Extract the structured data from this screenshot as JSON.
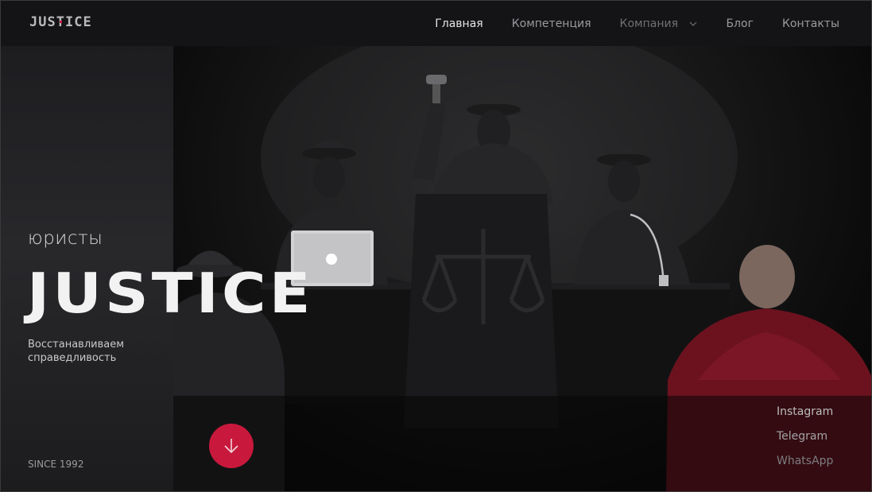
{
  "header": {
    "logo": {
      "before": "JUS",
      "accent": "T",
      "after": "ICE"
    },
    "nav": [
      {
        "label": "Главная"
      },
      {
        "label": "Компетенция"
      },
      {
        "label": "Компания"
      },
      {
        "label": "Блог"
      },
      {
        "label": "Контакты"
      }
    ]
  },
  "hero": {
    "kicker": "юристы",
    "title": "JUSTICE",
    "subtitle": "Восстанавливаем справедливость",
    "since": "SINCE 1992"
  },
  "social": [
    "Instagram",
    "Telegram",
    "WhatsApp"
  ],
  "colors": {
    "accent": "#c8193c",
    "header_bg": "#141416",
    "panel_bg": "#28282b"
  },
  "icons": {
    "scroll": "arrow-down-icon",
    "dropdown": "chevron-down-icon"
  }
}
